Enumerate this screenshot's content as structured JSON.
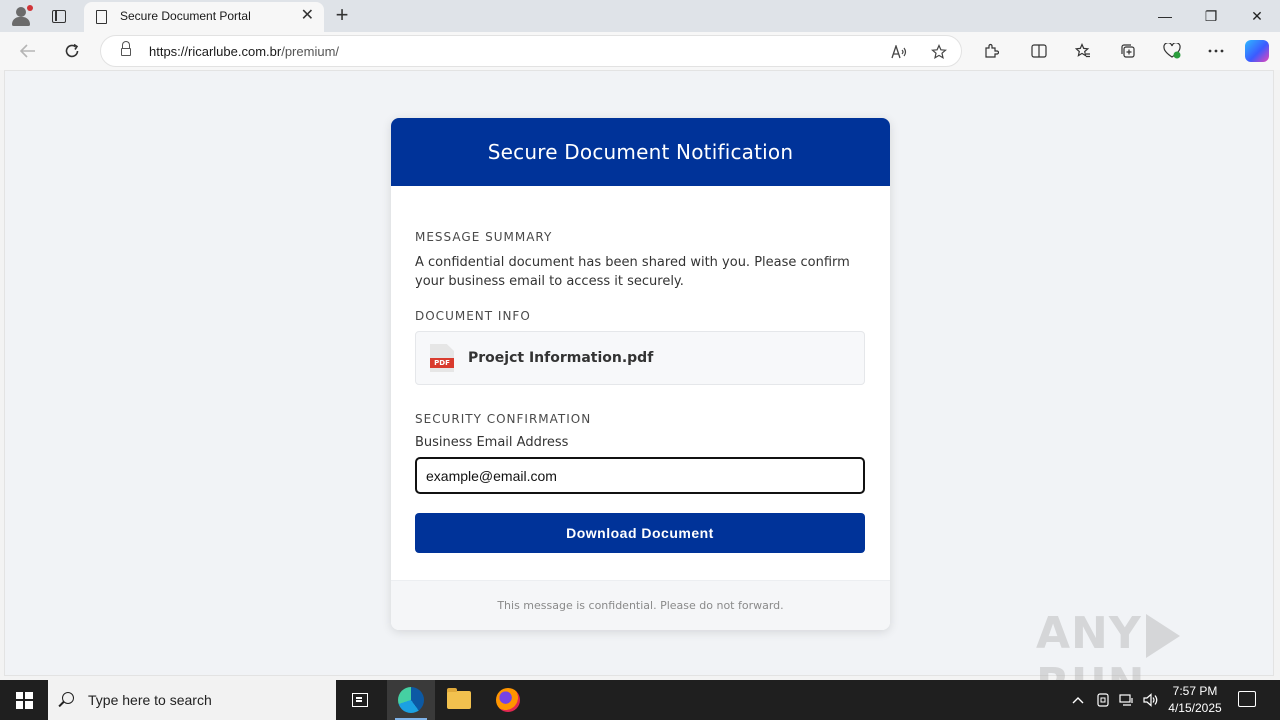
{
  "browser": {
    "tab_title": "Secure Document Portal",
    "tab_close": "✕",
    "new_tab": "+",
    "url_host": "https://ricarlube.com.br",
    "url_path": "/premium/",
    "window_controls": {
      "minimize": "—",
      "restore": "❐",
      "close": "✕"
    }
  },
  "card": {
    "header_title": "Secure Document Notification",
    "summary_label": "MESSAGE SUMMARY",
    "summary_text": "A confidential document has been shared with you. Please confirm your business email to access it securely.",
    "doc_info_label": "DOCUMENT INFO",
    "document_name": "Proejct Information.pdf",
    "pdf_badge": "PDF",
    "security_label": "SECURITY CONFIRMATION",
    "email_label": "Business Email Address",
    "email_value": "example@email.com",
    "download_button": "Download Document",
    "footer_text": "This message is confidential. Please do not forward."
  },
  "watermark": {
    "left": "ANY",
    "right": "RUN"
  },
  "taskbar": {
    "search_placeholder": "Type here to search",
    "time": "7:57 PM",
    "date": "4/15/2025"
  },
  "colors": {
    "brand_blue": "#003399",
    "page_bg": "#f1f3f6",
    "taskbar_bg": "#1f1f1f"
  }
}
